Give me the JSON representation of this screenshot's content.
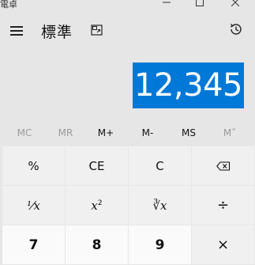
{
  "window": {
    "title": "電卓",
    "minimize_icon": "minimize-icon",
    "maximize_icon": "maximize-icon",
    "close_icon": "close-icon"
  },
  "header": {
    "menu_icon": "hamburger-menu-icon",
    "mode_title": "標準",
    "keep_on_top_icon": "keep-on-top-icon",
    "history_icon": "history-icon"
  },
  "display": {
    "value": "12,345"
  },
  "memory": {
    "mc": "MC",
    "mr": "MR",
    "m_plus": "M+",
    "m_minus": "M-",
    "ms": "MS",
    "m_list": "M˅"
  },
  "keypad": {
    "percent": "%",
    "clear_entry": "CE",
    "clear": "C",
    "backspace_icon": "backspace-icon",
    "reciprocal": "⅟x",
    "square_base": "x",
    "square_exp": "2",
    "cube_root": "∛x",
    "divide": "÷",
    "seven": "7",
    "eight": "8",
    "nine": "9",
    "multiply": "×"
  },
  "colors": {
    "accent": "#0078d7",
    "background": "#e6e6e6",
    "function_key": "#f0f0f0",
    "number_key": "#fafafa"
  }
}
